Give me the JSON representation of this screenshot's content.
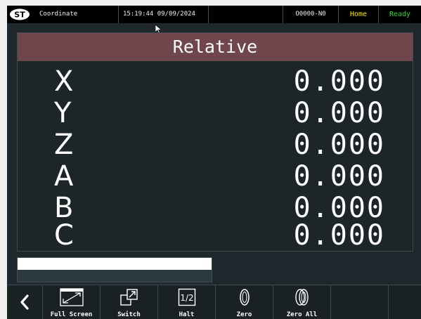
{
  "topbar": {
    "logo_text": "ST",
    "title": "Coordinate",
    "datetime": "15:19:44 09/09/2024",
    "program": "O0000-N0",
    "mode": "Home",
    "status": "Ready"
  },
  "colors": {
    "header_bg": "#6e464c",
    "mode_color": "#f5e800",
    "status_color": "#31d431",
    "screen_bg": "#1e272b"
  },
  "panel": {
    "header": "Relative",
    "rows": [
      {
        "axis": "X",
        "value": "0.000"
      },
      {
        "axis": "Y",
        "value": "0.000"
      },
      {
        "axis": "Z",
        "value": "0.000"
      },
      {
        "axis": "A",
        "value": "0.000"
      },
      {
        "axis": "B",
        "value": "0.000"
      },
      {
        "axis": "C",
        "value": "0.000"
      }
    ]
  },
  "softkeys": {
    "back_icon": "chevron-left-icon",
    "fullscreen": "Full Screen",
    "switch": "Switch",
    "halt": "Halt",
    "halt_icon_text": "1/2",
    "zero": "Zero",
    "zero_all": "Zero All"
  }
}
